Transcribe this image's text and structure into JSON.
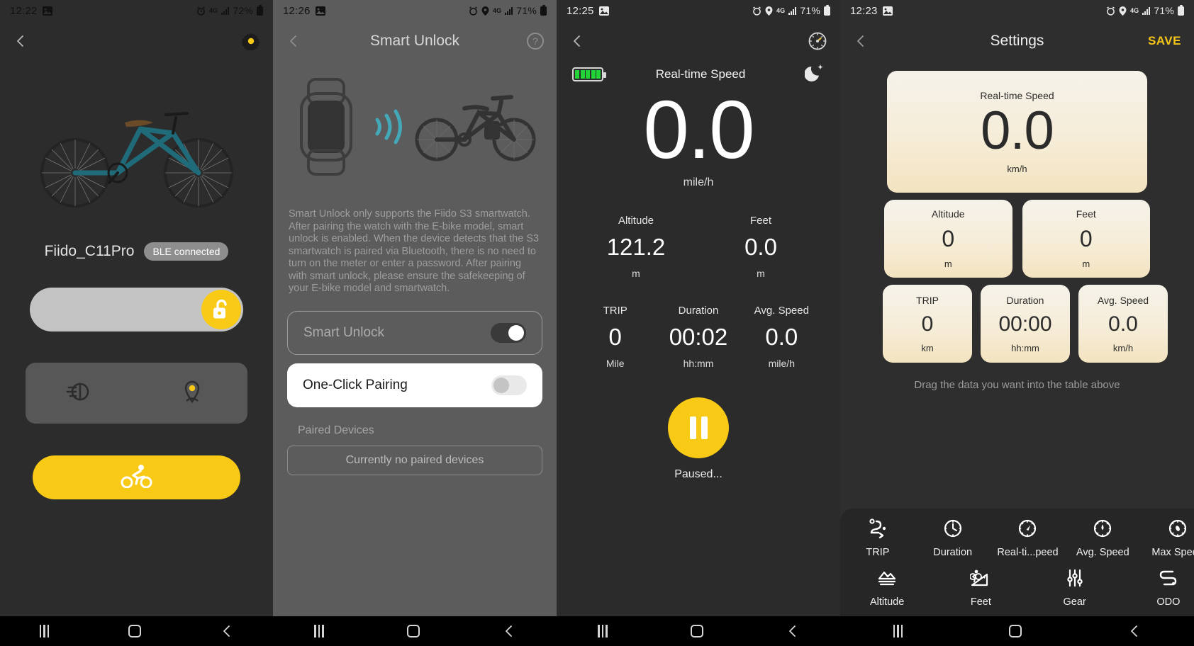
{
  "panel1": {
    "status": {
      "time": "12:22",
      "battery": "72%",
      "network": "4G"
    },
    "appbar": {
      "back_icon": "chevron-left-icon",
      "settings_icon": "gear-icon"
    },
    "device": {
      "name": "Fiido_C11Pro",
      "connection_badge": "BLE connected"
    },
    "lock": {
      "state_icon": "unlock-icon"
    },
    "controls": {
      "headlight_icon": "headlight-icon",
      "locate_icon": "locate-pin-icon"
    },
    "ride_button": {
      "icon": "cyclist-icon"
    }
  },
  "panel2": {
    "status": {
      "time": "12:26",
      "battery": "71%",
      "network": "4G"
    },
    "appbar": {
      "title": "Smart Unlock",
      "back_icon": "chevron-left-icon",
      "help_icon": "question-mark-icon"
    },
    "illustration": {
      "watch_icon": "smartwatch-icon",
      "signal_icon": "wireless-signal-icon",
      "bike_icon": "ebike-icon"
    },
    "description": "Smart Unlock only supports the Fiido S3 smartwatch. After pairing the watch with the E-bike model, smart unlock is enabled. When the device detects that the S3 smartwatch is paired via Bluetooth, there is no need to turn on the meter or enter a password. After pairing with smart unlock, please ensure the safekeeping of your E-bike model and smartwatch.",
    "rows": [
      {
        "label": "Smart Unlock",
        "toggle": "on"
      },
      {
        "label": "One-Click Pairing",
        "toggle": "off"
      }
    ],
    "paired_section_label": "Paired Devices",
    "paired_empty": "Currently no paired devices"
  },
  "panel3": {
    "status": {
      "time": "12:25",
      "battery": "71%",
      "network": "4G"
    },
    "appbar": {
      "back_icon": "chevron-left-icon",
      "dashboard_icon": "speedometer-icon"
    },
    "battery_icon": "battery-level-icon",
    "night_icon": "moon-icon",
    "primary": {
      "label": "Real-time Speed",
      "value": "0.0",
      "unit": "mile/h"
    },
    "metrics_row1": [
      {
        "label": "Altitude",
        "value": "121.2",
        "unit": "m"
      },
      {
        "label": "Feet",
        "value": "0.0",
        "unit": "m"
      }
    ],
    "metrics_row2": [
      {
        "label": "TRIP",
        "value": "0",
        "unit": "Mile"
      },
      {
        "label": "Duration",
        "value": "00:02",
        "unit": "hh:mm"
      },
      {
        "label": "Avg. Speed",
        "value": "0.0",
        "unit": "mile/h"
      }
    ],
    "pause": {
      "icon": "pause-icon",
      "status_text": "Paused..."
    }
  },
  "panel4": {
    "status": {
      "time": "12:23",
      "battery": "71%",
      "network": "4G"
    },
    "appbar": {
      "title": "Settings",
      "back_icon": "chevron-left-icon",
      "save_label": "SAVE"
    },
    "main_tile": {
      "label": "Real-time Speed",
      "value": "0.0",
      "unit": "km/h"
    },
    "tiles_row2": [
      {
        "label": "Altitude",
        "value": "0",
        "unit": "m"
      },
      {
        "label": "Feet",
        "value": "0",
        "unit": "m"
      }
    ],
    "tiles_row3": [
      {
        "label": "TRIP",
        "value": "0",
        "unit": "km"
      },
      {
        "label": "Duration",
        "value": "00:00",
        "unit": "hh:mm"
      },
      {
        "label": "Avg. Speed",
        "value": "0.0",
        "unit": "km/h"
      }
    ],
    "hint": "Drag the data you want into the table above",
    "tray_row1": [
      {
        "label": "TRIP",
        "icon": "route-icon"
      },
      {
        "label": "Duration",
        "icon": "clock-icon"
      },
      {
        "label": "Real-ti...peed",
        "icon": "speedometer-icon"
      },
      {
        "label": "Avg. Speed",
        "icon": "speedometer-avg-icon"
      },
      {
        "label": "Max Speed",
        "icon": "speedometer-max-icon"
      }
    ],
    "tray_row2": [
      {
        "label": "Altitude",
        "icon": "mountain-icon"
      },
      {
        "label": "Feet",
        "icon": "cyclist-hill-icon"
      },
      {
        "label": "Gear",
        "icon": "sliders-icon"
      },
      {
        "label": "ODO",
        "icon": "odometer-route-icon"
      }
    ]
  },
  "navbar": {
    "recents_icon": "recents-icon",
    "home_icon": "home-icon",
    "back_icon": "chevron-left-icon"
  },
  "colors": {
    "accent": "#f9ca15",
    "save": "#f5c518",
    "battery_green": "#22d337"
  }
}
